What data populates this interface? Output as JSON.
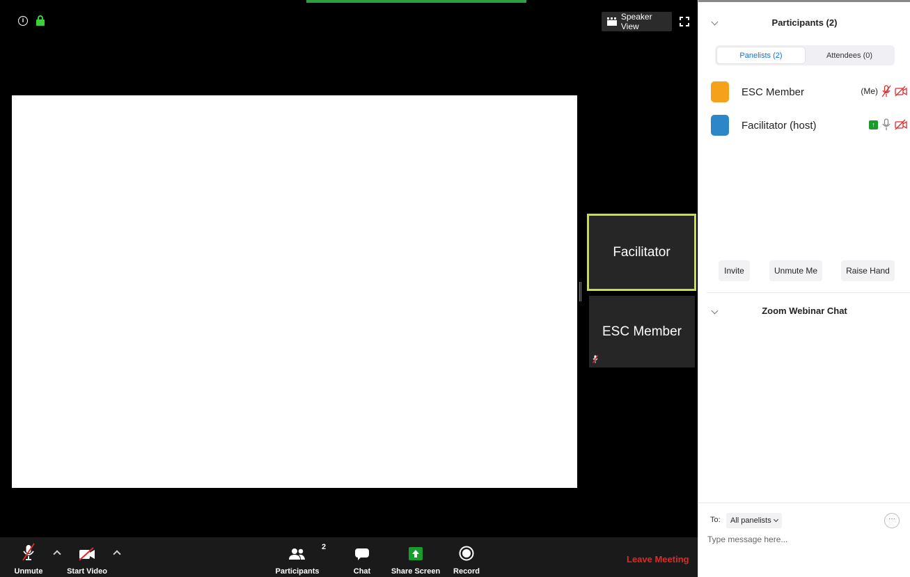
{
  "meeting": {
    "speaker_view_label": "Speaker View",
    "tiles": {
      "facilitator": "Facilitator",
      "esc_member": "ESC Member"
    },
    "icons": [
      "info-icon",
      "lock-icon",
      "speaker-view-grid-icon",
      "fullscreen-icon"
    ]
  },
  "toolbar": {
    "unmute_label": "Unmute",
    "start_video_label": "Start Video",
    "participants_label": "Participants",
    "participants_count": "2",
    "chat_label": "Chat",
    "share_screen_label": "Share Screen",
    "record_label": "Record",
    "leave_label": "Leave Meeting"
  },
  "participants_panel": {
    "title": "Participants (2)",
    "tabs": [
      {
        "label": "Panelists (2)",
        "active": true
      },
      {
        "label": "Attendees (0)",
        "active": false
      }
    ],
    "panelists": [
      {
        "name": "ESC Member",
        "tag": "(Me)",
        "avatar_color": "#f5a11c",
        "mic": "muted",
        "video": "off"
      },
      {
        "name": "Facilitator (host)",
        "tag": "",
        "avatar_color": "#2d86c8",
        "sharing": true,
        "mic": "on",
        "video": "off"
      }
    ],
    "actions": {
      "invite": "Invite",
      "unmute_me": "Unmute Me",
      "raise_hand": "Raise Hand"
    }
  },
  "chat_panel": {
    "title": "Zoom Webinar Chat",
    "to_label": "To:",
    "to_value": "All panelists",
    "more_label": "···",
    "input_placeholder": "Type message here..."
  },
  "colors": {
    "active_speaker_border": "#c6e13d",
    "leave": "#e02828",
    "accent_blue": "#0e71eb",
    "share_green": "#1a9b2e",
    "muted_red": "#e02828"
  }
}
